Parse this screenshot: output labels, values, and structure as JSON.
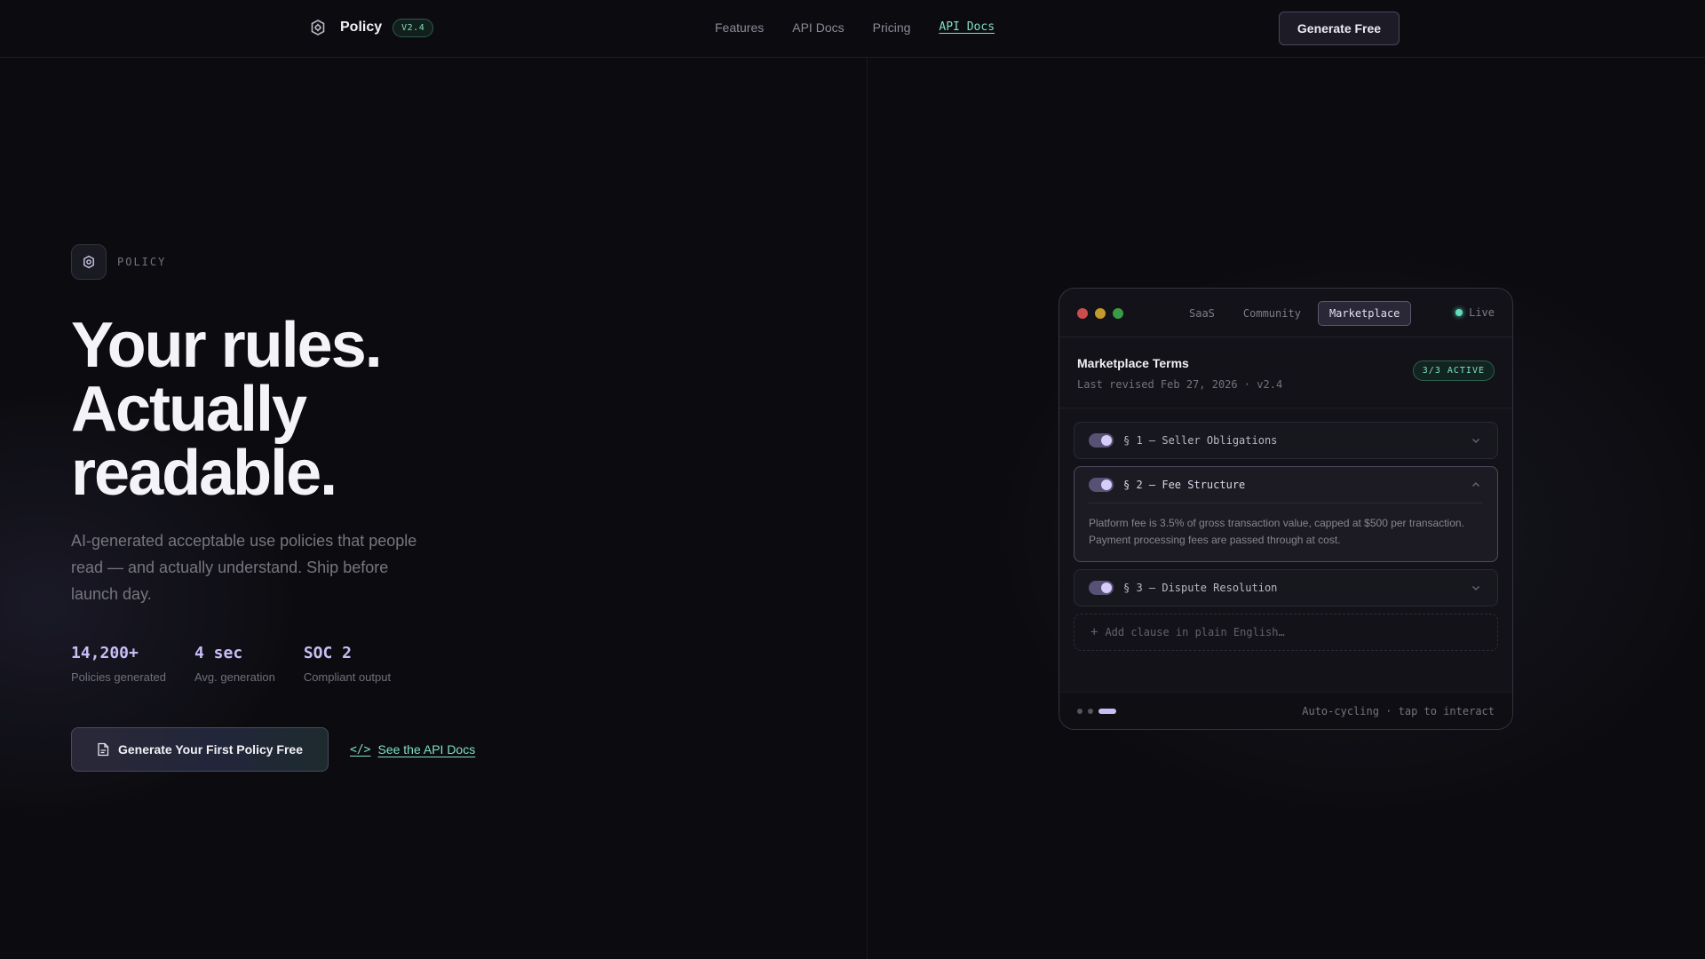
{
  "nav": {
    "brand_name": "Policy",
    "version": "V2.4",
    "links": [
      "Features",
      "API Docs",
      "Pricing",
      "API Docs"
    ],
    "cta_label": "Generate Free"
  },
  "hero": {
    "eyebrow": "POLICY",
    "headline": [
      "Your rules.",
      "Actually",
      "readable."
    ],
    "subhead": "AI-generated acceptable use policies that people read — and actually understand. Ship before launch day.",
    "stats": [
      {
        "value": "14,200+",
        "label": "Policies generated"
      },
      {
        "value": "4 sec",
        "label": "Avg. generation"
      },
      {
        "value": "SOC 2",
        "label": "Compliant output"
      }
    ],
    "cta_primary": "Generate Your First Policy Free",
    "cta_secondary_icon": "</>",
    "cta_secondary": "See the API Docs"
  },
  "preview": {
    "tabs": [
      "SaaS",
      "Community",
      "Marketplace"
    ],
    "active_tab": "Marketplace",
    "live_label": "Live",
    "doc_title": "Marketplace Terms",
    "doc_meta": "Last revised Feb 27, 2026 · v2.4",
    "active_badge": "3/3 ACTIVE",
    "clauses": [
      {
        "label": "§ 1 — Seller Obligations",
        "open": false,
        "body": ""
      },
      {
        "label": "§ 2 — Fee Structure",
        "open": true,
        "body": "Platform fee is 3.5% of gross transaction value, capped at $500 per transaction. Payment processing fees are passed through at cost."
      },
      {
        "label": "§ 3 — Dispute Resolution",
        "open": false,
        "body": ""
      }
    ],
    "add_clause_placeholder": "Add clause in plain English…",
    "footer_text": "Auto-cycling · tap to interact"
  },
  "colors": {
    "accent_mint": "#7fe0c2",
    "accent_lavender": "#c8bdf5",
    "background": "#0c0c10"
  }
}
